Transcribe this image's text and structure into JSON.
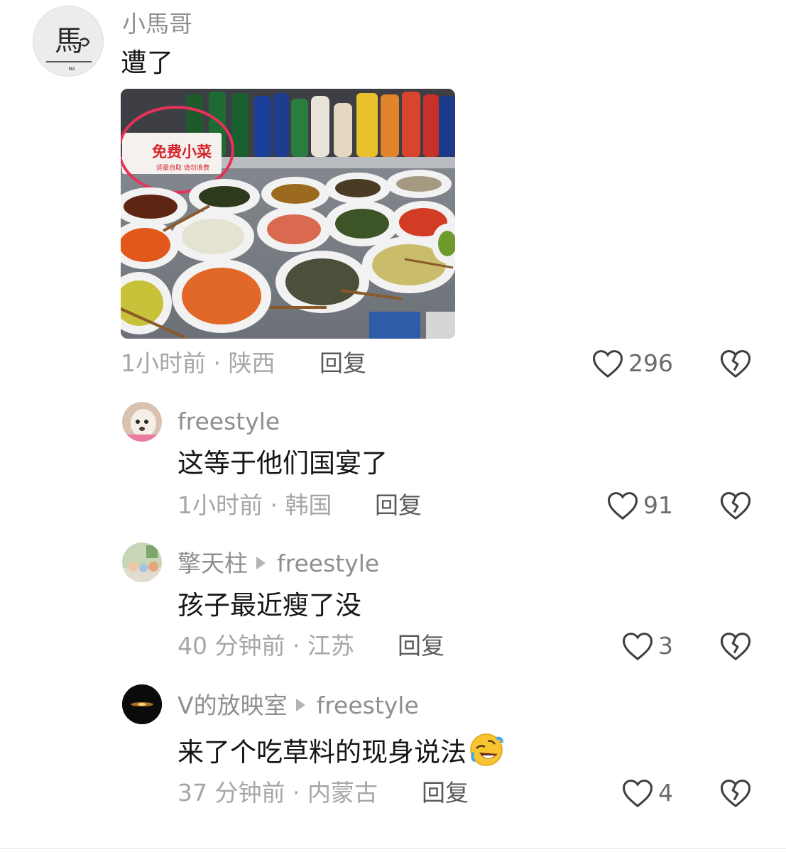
{
  "comments": [
    {
      "author": "小馬哥",
      "text": "遭了",
      "time_location": "1小时前 · 陕西",
      "reply_label": "回复",
      "like_count": "296",
      "avatar_text": "馬",
      "avatar_caption": "MA",
      "image": {
        "sign_title": "免费小菜",
        "sign_subtitle": "适量自取 请勿浪费"
      }
    },
    {
      "author": "freestyle",
      "text": "这等于他们国宴了",
      "time_location": "1小时前 · 韩国",
      "reply_label": "回复",
      "like_count": "91"
    },
    {
      "author": "擎天柱",
      "reply_to": "freestyle",
      "text": "孩子最近瘦了没",
      "time_location": "40 分钟前 · 江苏",
      "reply_label": "回复",
      "like_count": "3"
    },
    {
      "author": "V的放映室",
      "reply_to": "freestyle",
      "text": "来了个吃草料的现身说法",
      "time_location": "37 分钟前 · 内蒙古",
      "reply_label": "回复",
      "like_count": "4"
    }
  ],
  "icons": {
    "like": "heart-outline-icon",
    "dislike": "broken-heart-icon",
    "emoji": "rolling-on-floor-laughing-emoji"
  },
  "colors": {
    "author": "#8f8f8f",
    "meta": "#a6a6a6",
    "text": "#161616",
    "icon": "#3f3f3f"
  }
}
